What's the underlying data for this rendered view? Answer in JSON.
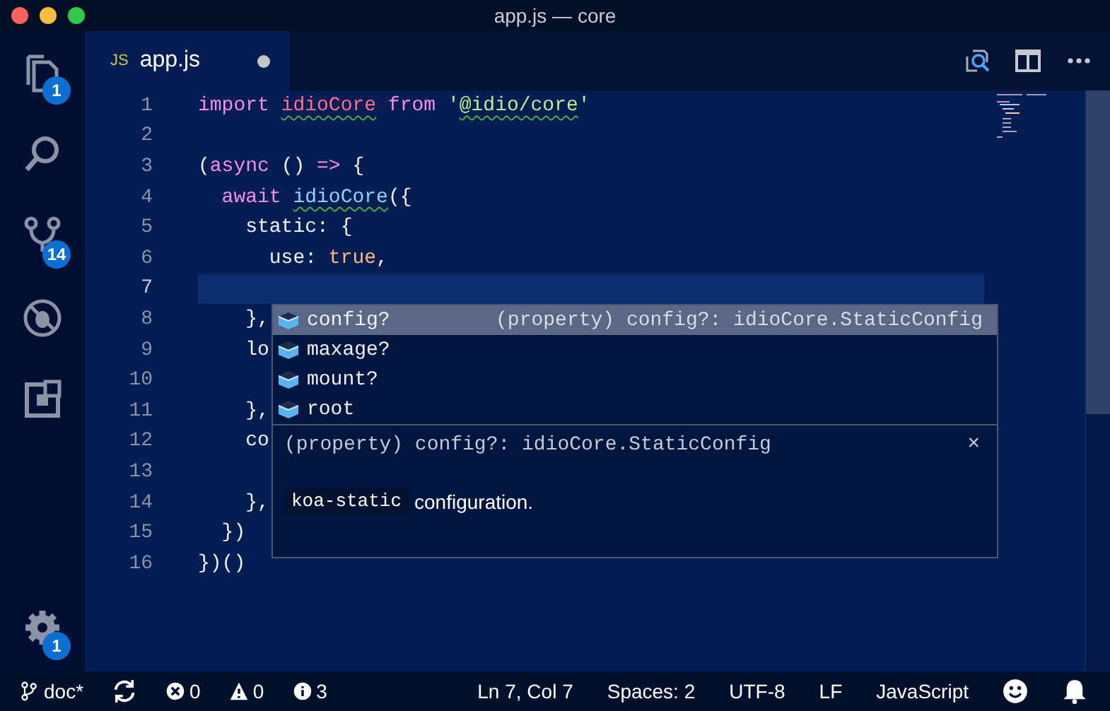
{
  "window": {
    "title": "app.js — core"
  },
  "activity_bar": {
    "items": [
      {
        "kind": "explorer",
        "badge": "1"
      },
      {
        "kind": "search"
      },
      {
        "kind": "scm",
        "badge": "14"
      },
      {
        "kind": "debug"
      },
      {
        "kind": "extensions"
      }
    ],
    "bottom": [
      {
        "kind": "settings",
        "badge": "1"
      }
    ]
  },
  "tab": {
    "icon_text": "JS",
    "label": "app.js",
    "dirty": true
  },
  "editor": {
    "lines": [
      {
        "number": "1",
        "current": false,
        "tokens": [
          {
            "kind": "kw",
            "text": "import "
          },
          {
            "kind": "var",
            "text": "idioCore",
            "squiggle": true
          },
          {
            "kind": "kw",
            "text": " from "
          },
          {
            "kind": "str",
            "text": "'"
          },
          {
            "kind": "str",
            "text": "@idio/core",
            "squiggle": true
          },
          {
            "kind": "str",
            "text": "'"
          }
        ]
      },
      {
        "number": "2",
        "current": false
      },
      {
        "number": "3",
        "current": false,
        "tokens": [
          {
            "kind": "plain",
            "text": "("
          },
          {
            "kind": "kw",
            "text": "async"
          },
          {
            "kind": "plain",
            "text": " () "
          },
          {
            "kind": "kw",
            "text": "=>"
          },
          {
            "kind": "plain",
            "text": " {"
          }
        ]
      },
      {
        "number": "4",
        "current": false,
        "tokens": [
          {
            "kind": "kw",
            "text": "  await "
          },
          {
            "kind": "fn",
            "text": "idioCore",
            "squiggle": true
          },
          {
            "kind": "plain",
            "text": "({"
          }
        ]
      },
      {
        "number": "5",
        "current": false,
        "tokens": [
          {
            "kind": "plain",
            "text": "    static: {"
          }
        ]
      },
      {
        "number": "6",
        "current": false,
        "tokens": [
          {
            "kind": "plain",
            "text": "      use: "
          },
          {
            "kind": "bool",
            "text": "true"
          },
          {
            "kind": "plain",
            "text": ","
          }
        ]
      },
      {
        "number": "7",
        "current": true
      },
      {
        "number": "8",
        "current": false,
        "tokens": [
          {
            "kind": "plain",
            "text": "    },"
          }
        ]
      },
      {
        "number": "9",
        "current": false,
        "tokens": [
          {
            "kind": "plain",
            "text": "    lo"
          }
        ]
      },
      {
        "number": "10",
        "current": false
      },
      {
        "number": "11",
        "current": false,
        "tokens": [
          {
            "kind": "plain",
            "text": "    },"
          }
        ]
      },
      {
        "number": "12",
        "current": false,
        "tokens": [
          {
            "kind": "plain",
            "text": "    co"
          }
        ]
      },
      {
        "number": "13",
        "current": false
      },
      {
        "number": "14",
        "current": false,
        "tokens": [
          {
            "kind": "plain",
            "text": "    },"
          }
        ]
      },
      {
        "number": "15",
        "current": false,
        "tokens": [
          {
            "kind": "plain",
            "text": "  })"
          }
        ]
      },
      {
        "number": "16",
        "current": false,
        "tokens": [
          {
            "kind": "plain",
            "text": "})()"
          }
        ]
      }
    ]
  },
  "suggestions": {
    "items": [
      {
        "label": "config?",
        "selected": true,
        "detail": "(property) config?: idioCore.StaticConfig"
      },
      {
        "label": "maxage?",
        "selected": false
      },
      {
        "label": "mount?",
        "selected": false
      },
      {
        "label": "root",
        "selected": false
      }
    ],
    "details": {
      "signature": "(property) config?: idioCore.StaticConfig",
      "close": "×",
      "doc_code": "koa-static",
      "doc_text": "configuration."
    }
  },
  "status_bar": {
    "left": [
      {
        "kind": "branch",
        "text": "doc*"
      },
      {
        "kind": "sync"
      },
      {
        "kind": "errors",
        "text": "0"
      },
      {
        "kind": "warnings",
        "text": "0"
      },
      {
        "kind": "info",
        "text": "3"
      }
    ],
    "right": [
      {
        "kind": "text",
        "text": "Ln 7, Col 7"
      },
      {
        "kind": "text",
        "text": "Spaces: 2"
      },
      {
        "kind": "text",
        "text": "UTF-8"
      },
      {
        "kind": "text",
        "text": "LF"
      },
      {
        "kind": "text",
        "text": "JavaScript"
      },
      {
        "kind": "feedback"
      },
      {
        "kind": "bell"
      }
    ]
  }
}
